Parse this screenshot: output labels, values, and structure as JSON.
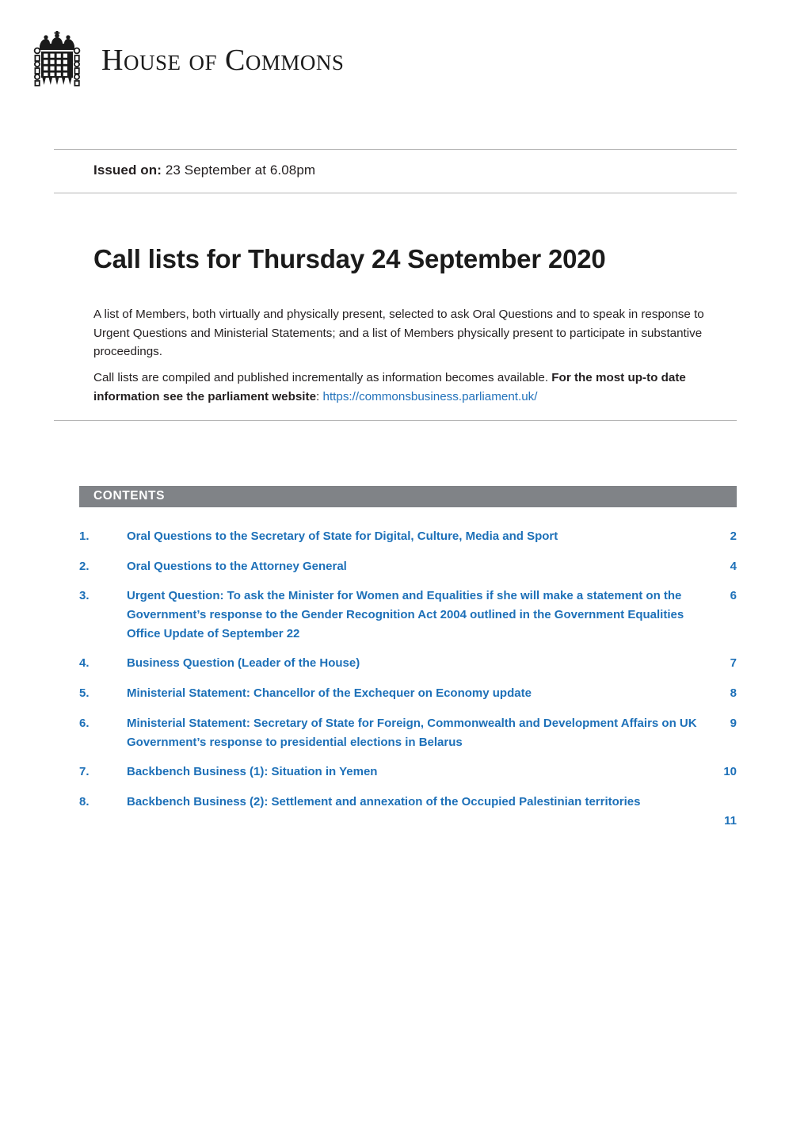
{
  "masthead": {
    "logo_name": "crowned-portcullis",
    "title_part_1": "H",
    "title_part_2": "OUSE",
    "title_part_3": "OF",
    "title_part_4": "C",
    "title_part_5": "OMMONS",
    "title_full": "HOUSE OF COMMONS"
  },
  "header": {
    "issued_label": "Issued on:",
    "issued_value": " 23 September at 6.08pm",
    "title": "Call lists for Thursday 24 September 2020"
  },
  "intro": {
    "paragraph_1": "A list of Members, both virtually and physically present, selected to ask Oral Questions and to speak in response to Urgent Questions and Ministerial Statements; and a list of Members physically present to participate in substantive proceedings.",
    "paragraph_2_plain_1": "Call lists are compiled and published incrementally as information becomes available. ",
    "paragraph_2_bold": "For the most up-to date information see the parliament website",
    "paragraph_2_plain_2": ": ",
    "paragraph_2_url": "https://commonsbusiness.parliament.uk/"
  },
  "contents": {
    "bar_label": "CONTENTS",
    "items": [
      {
        "number": "1.",
        "label": "Oral Questions to the Secretary of State for Digital, Culture, Media and Sport",
        "page": "2"
      },
      {
        "number": "2.",
        "label": "Oral Questions to the Attorney General",
        "page": "4"
      },
      {
        "number": "3.",
        "label": "Urgent Question: To ask the Minister for Women and Equalities if she will make a statement on the Government’s response to the Gender Recognition Act 2004 outlined in the Government Equalities Office Update of September 22",
        "page": "6"
      },
      {
        "number": "4.",
        "label": "Business Question (Leader of the House)",
        "page": "7"
      },
      {
        "number": "5.",
        "label": "Ministerial Statement: Chancellor of the Exchequer on Economy update",
        "page": "8"
      },
      {
        "number": "6.",
        "label": "Ministerial Statement: Secretary of State for Foreign, Commonwealth and Development Affairs on UK Government’s response to presidential elections in Belarus",
        "page": "9"
      },
      {
        "number": "7.",
        "label": "Backbench Business (1): Situation in Yemen",
        "page": "10"
      },
      {
        "number": "8.",
        "label": "Backbench Business (2): Settlement and annexation of the Occupied Palestinian territories",
        "page": "11"
      }
    ]
  },
  "colors": {
    "link_blue": "#1d70b8",
    "url_blue": "#2272bb",
    "contents_bar_gray": "#808387",
    "rule_gray": "#b5b5b5",
    "body_text": "#231f20"
  }
}
